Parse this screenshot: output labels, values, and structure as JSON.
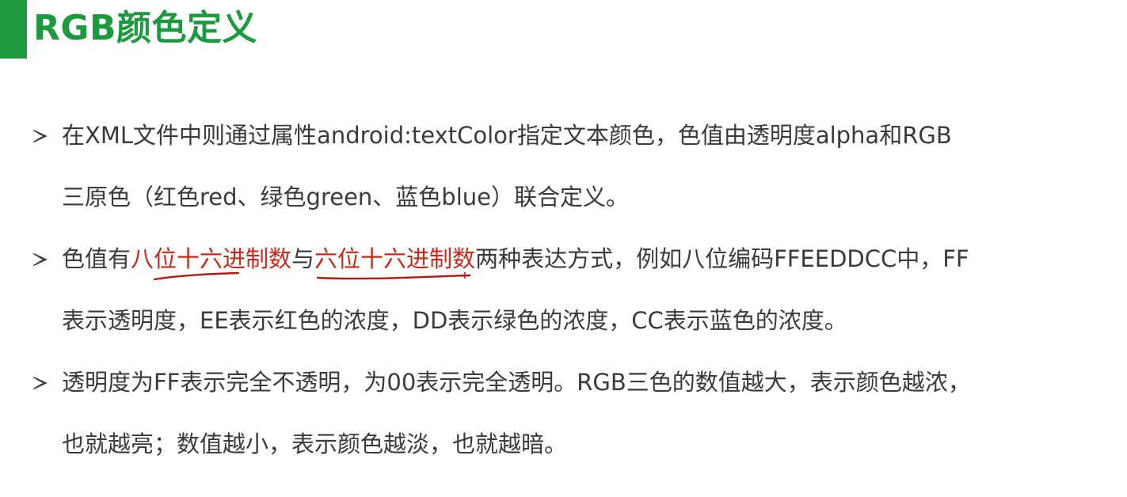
{
  "slide": {
    "title": "RGB颜色定义",
    "accent_color": "#1d9a3f",
    "highlight_color": "#c62a1c",
    "bullets": [
      {
        "line1": "在XML文件中则通过属性android:textColor指定文本颜色，色值由透明度alpha和RGB",
        "line2": "三原色（红色red、绿色green、蓝色blue）联合定义。"
      },
      {
        "line1_pre": "色值有",
        "line1_hl1": "八位十六进制数",
        "line1_mid": "与",
        "line1_hl2": "六位十六进制数",
        "line1_post": "两种表达方式，例如八位编码FFEEDDCC中，FF",
        "line2": "表示透明度，EE表示红色的浓度，DD表示绿色的浓度，CC表示蓝色的浓度。"
      },
      {
        "line1": "透明度为FF表示完全不透明，为00表示完全透明。RGB三色的数值越大，表示颜色越浓，",
        "line2": "也就越亮；数值越小，表示颜色越淡，也就越暗。"
      }
    ]
  }
}
